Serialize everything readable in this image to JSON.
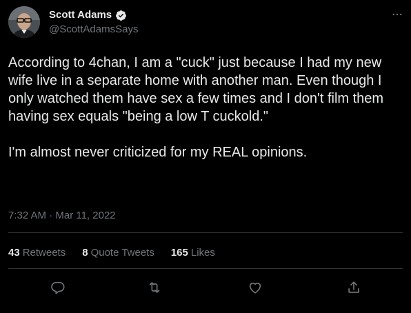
{
  "author": {
    "display_name": "Scott Adams",
    "handle": "@ScottAdamsSays",
    "verified": true
  },
  "tweet": {
    "text": "According to 4chan, I am a \"cuck\" just because I had my new wife live in a separate home with another man. Even though I only watched them have sex a few times and I don't film them having sex equals \"being a low T cuckold.\"\n\nI'm almost never criticized for my REAL opinions.",
    "timestamp": "7:32 AM · Mar 11, 2022"
  },
  "stats": {
    "retweets_count": "43",
    "retweets_label": "Retweets",
    "quotes_count": "8",
    "quotes_label": "Quote Tweets",
    "likes_count": "165",
    "likes_label": "Likes"
  },
  "icons": {
    "more": "more-horizontal-icon",
    "verified": "verified-badge-icon",
    "reply": "reply-icon",
    "retweet": "retweet-icon",
    "like": "heart-icon",
    "share": "share-icon"
  },
  "colors": {
    "background": "#000000",
    "text_primary": "#e7e9ea",
    "text_secondary": "#71767b",
    "divider": "#2f3336",
    "verified": "#e7e9ea"
  }
}
